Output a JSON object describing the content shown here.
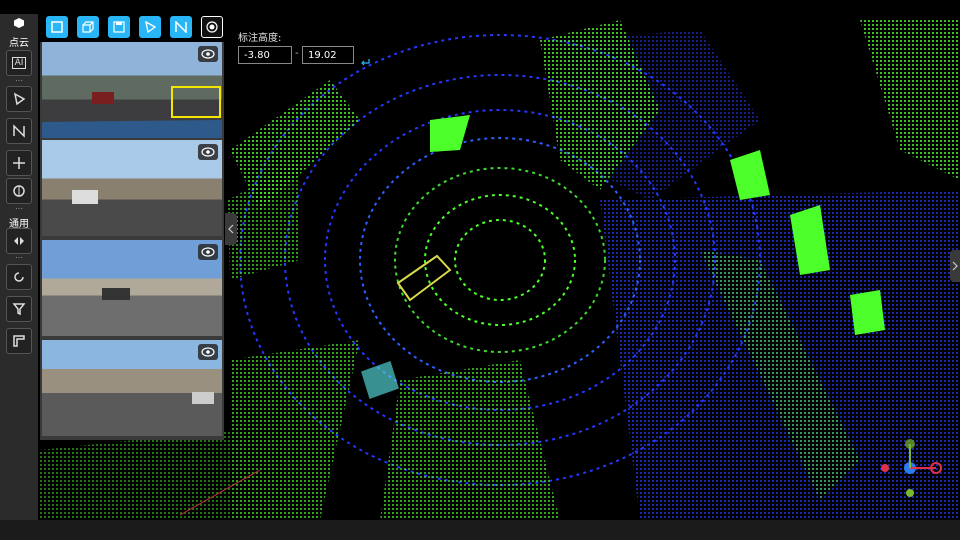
{
  "toolbar": {
    "pointcloud_label": "点云",
    "general_label": "通用",
    "tools_pointcloud": [
      "ai-tool-icon",
      "polygon-icon",
      "polyline-icon",
      "move-icon",
      "brain-icon"
    ],
    "tools_general": [
      "flip-icon",
      "rotate-icon",
      "filter-icon",
      "ruler-icon"
    ]
  },
  "top_tools": [
    "rect-box-icon",
    "cuboid-icon",
    "save-box-icon",
    "polygon-flag-icon",
    "n-path-icon",
    "radio-record-icon"
  ],
  "height_filter": {
    "label": "标注高度:",
    "min_value": "-3.80",
    "separator": "-",
    "max_value": "19.02"
  },
  "cameras": [
    "camera-1",
    "camera-2",
    "camera-3",
    "camera-4"
  ],
  "colors": {
    "accent": "#29b6f6",
    "points_green": "#4cff2a",
    "points_blue": "#2438ff",
    "box_yellow": "#d8d84a",
    "box_cyan": "#5ef0f0",
    "axis_red": "#e0304a",
    "axis_green": "#7ab82e",
    "axis_blue": "#2a7cf0"
  }
}
